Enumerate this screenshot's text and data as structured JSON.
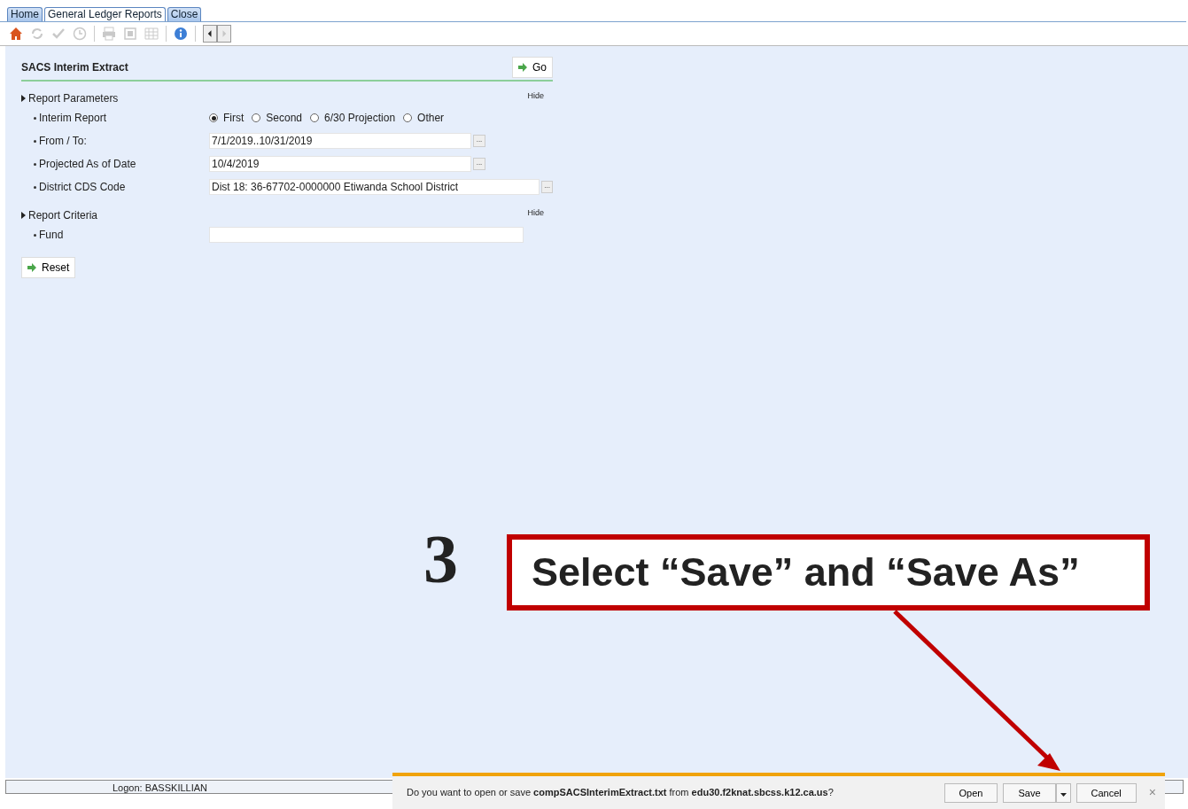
{
  "tabs": [
    {
      "label": "Home",
      "selected": false
    },
    {
      "label": "General Ledger Reports",
      "selected": true
    },
    {
      "label": "Close",
      "selected": false
    }
  ],
  "toolbar": [
    {
      "kind": "home",
      "disabled": false
    },
    {
      "kind": "refresh",
      "disabled": true
    },
    {
      "kind": "check",
      "disabled": true
    },
    {
      "kind": "clock",
      "disabled": true
    },
    {
      "kind": "sep"
    },
    {
      "kind": "print",
      "disabled": true
    },
    {
      "kind": "export",
      "disabled": true
    },
    {
      "kind": "grid",
      "disabled": true
    },
    {
      "kind": "sep"
    },
    {
      "kind": "info",
      "disabled": false
    },
    {
      "kind": "sep"
    },
    {
      "kind": "prev",
      "disabled": false
    },
    {
      "kind": "next",
      "disabled": true
    }
  ],
  "form": {
    "title": "SACS Interim Extract",
    "go_button": "Go",
    "sections": [
      {
        "title": "Report Parameters",
        "hide": "Hide",
        "fields": [
          {
            "kind": "radio",
            "label": "Interim Report",
            "options": [
              {
                "label": "First",
                "selected": true
              },
              {
                "label": "Second",
                "selected": false
              },
              {
                "label": "6/30 Projection",
                "selected": false
              },
              {
                "label": "Other",
                "selected": false
              }
            ]
          },
          {
            "kind": "lookup",
            "label": "From / To:",
            "value": "7/1/2019..10/31/2019",
            "button": "..."
          },
          {
            "kind": "lookup",
            "label": "Projected As of Date",
            "value": "10/4/2019",
            "button": "..."
          },
          {
            "kind": "lookup",
            "label": "District CDS Code",
            "value": "Dist 18: 36-67702-0000000 Etiwanda School District",
            "button": "..."
          }
        ]
      },
      {
        "title": "Report Criteria",
        "hide": "Hide",
        "fields": [
          {
            "kind": "text",
            "label": "Fund"
          }
        ]
      }
    ],
    "reset_button": "Reset"
  },
  "status_bar": {
    "logon": "Logon: BASSKILLIAN"
  },
  "annotation": {
    "step": "3",
    "callout": "Select “Save” and “Save As”"
  },
  "download_bar": {
    "message": "Do you want to open or save **compSACSInterimExtract.txt** from **edu30.f2knat.sbcss.k12.ca.us**?",
    "buttons": [
      "Open",
      "Save",
      "Cancel"
    ],
    "close": "×"
  }
}
